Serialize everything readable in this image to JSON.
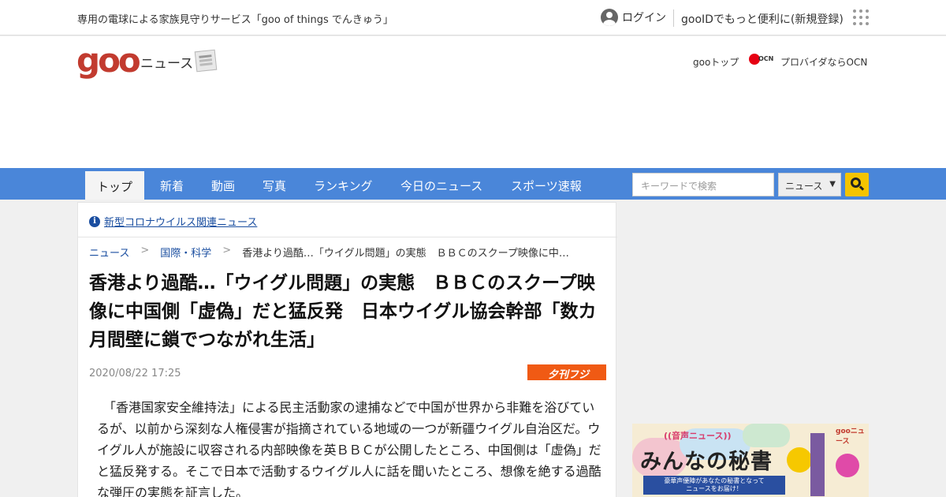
{
  "topbar": {
    "promo": "専用の電球による家族見守りサービス「goo of things でんきゅう」",
    "login": "ログイン",
    "register": "gooIDでもっと便利に(新規登録)"
  },
  "header": {
    "logo": "goo",
    "logo_sub": "ニュース",
    "goo_top": "gooトップ",
    "ocn_badge": "OCN",
    "ocn_label": "プロバイダならOCN"
  },
  "nav": {
    "tabs": [
      {
        "label": "トップ",
        "active": true
      },
      {
        "label": "新着"
      },
      {
        "label": "動画"
      },
      {
        "label": "写真"
      },
      {
        "label": "ランキング"
      },
      {
        "label": "今日のニュース"
      },
      {
        "label": "スポーツ速報"
      }
    ],
    "search_placeholder": "キーワードで検索",
    "search_scope": "ニュース",
    "accent_color": "#4a86d9",
    "search_button_color": "#f5c400"
  },
  "article": {
    "covid_link": "新型コロナウイルス関連ニュース",
    "breadcrumb": [
      "ニュース",
      "国際・科学",
      "香港より過酷…「ウイグル問題」の実態　ＢＢＣのスクープ映像に中…"
    ],
    "title": "香港より過酷…「ウイグル問題」の実態　ＢＢＣのスクープ映像に中国側「虚偽」だと猛反発　日本ウイグル協会幹部「数カ月間壁に鎖でつながれ生活」",
    "date": "2020/08/22 17:25",
    "source": "夕刊フジ",
    "body": "　「香港国家安全維持法」による民主活動家の逮捕などで中国が世界から非難を浴びているが、以前から深刻な人権侵害が指摘されている地域の一つが新疆ウイグル自治区だ。ウイグル人が施設に収容される内部映像を英ＢＢＣが公開したところ、中国側は「虚偽」だと猛反発する。そこで日本で活動するウイグル人に話を聞いたところ、想像を絶する過酷な弾圧の実態を証言した。"
  },
  "ad": {
    "voice_label": "((音声ニュース))",
    "goo_news": "gooニュース",
    "headline": "みんなの秘書",
    "banner_line1": "豪華声優陣があなたの秘書となって",
    "banner_line2": "ニュースをお届け！"
  }
}
